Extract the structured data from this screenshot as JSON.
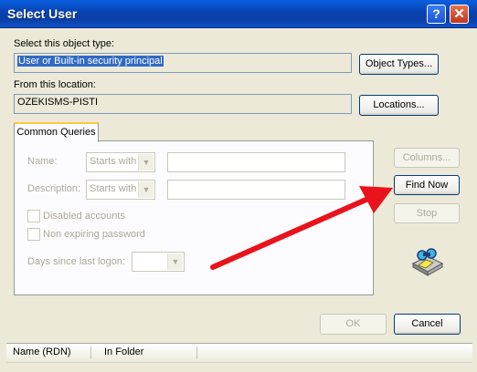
{
  "window": {
    "title": "Select User",
    "help_glyph": "?",
    "close_glyph": "✕"
  },
  "object_type": {
    "label": "Select this object type:",
    "value": "User or Built-in security principal",
    "button": "Object Types..."
  },
  "location": {
    "label": "From this location:",
    "value": "OZEKISMS-PISTI",
    "button": "Locations..."
  },
  "queries": {
    "tab": "Common Queries",
    "name_label": "Name:",
    "name_mode": "Starts with",
    "description_label": "Description:",
    "description_mode": "Starts with",
    "disabled_accounts": "Disabled accounts",
    "non_expiring_password": "Non expiring password",
    "days_since_logon": "Days since last logon:",
    "columns_button": "Columns...",
    "find_now_button": "Find Now",
    "stop_button": "Stop",
    "search_icon": "search-binoculars-icon",
    "annotation_color": "#E8131B"
  },
  "footer": {
    "ok": "OK",
    "cancel": "Cancel"
  },
  "results": {
    "columns": [
      "Name (RDN)",
      "In Folder"
    ]
  }
}
